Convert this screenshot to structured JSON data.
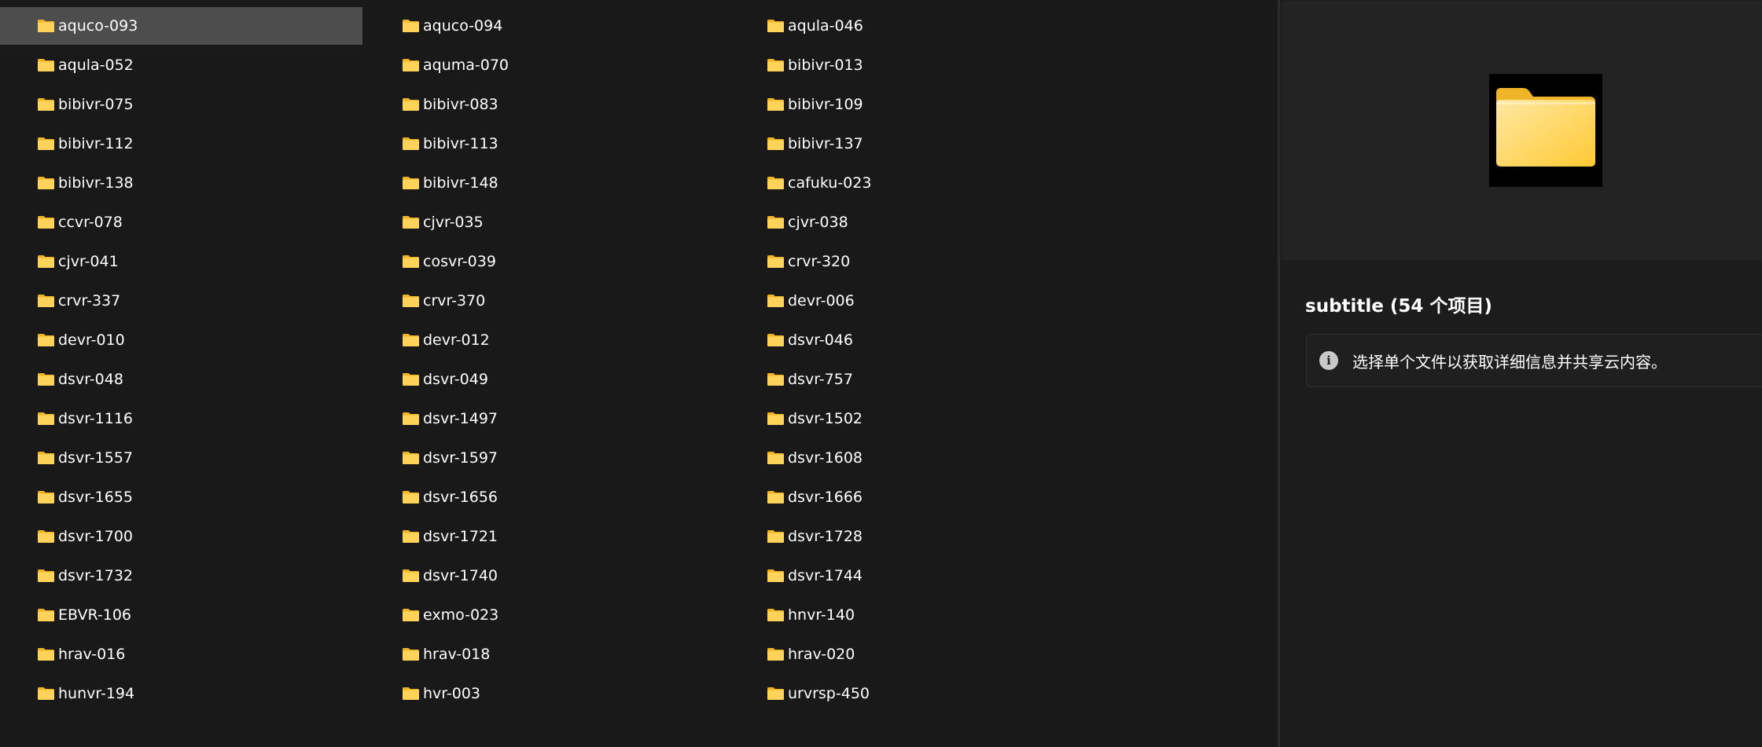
{
  "files": {
    "selected_index": 0,
    "items": [
      "aquco-093",
      "aquco-094",
      "aqula-046",
      "aqula-052",
      "aquma-070",
      "bibivr-013",
      "bibivr-075",
      "bibivr-083",
      "bibivr-109",
      "bibivr-112",
      "bibivr-113",
      "bibivr-137",
      "bibivr-138",
      "bibivr-148",
      "cafuku-023",
      "ccvr-078",
      "cjvr-035",
      "cjvr-038",
      "cjvr-041",
      "cosvr-039",
      "crvr-320",
      "crvr-337",
      "crvr-370",
      "devr-006",
      "devr-010",
      "devr-012",
      "dsvr-046",
      "dsvr-048",
      "dsvr-049",
      "dsvr-757",
      "dsvr-1116",
      "dsvr-1497",
      "dsvr-1502",
      "dsvr-1557",
      "dsvr-1597",
      "dsvr-1608",
      "dsvr-1655",
      "dsvr-1656",
      "dsvr-1666",
      "dsvr-1700",
      "dsvr-1721",
      "dsvr-1728",
      "dsvr-1732",
      "dsvr-1740",
      "dsvr-1744",
      "EBVR-106",
      "exmo-023",
      "hnvr-140",
      "hrav-016",
      "hrav-018",
      "hrav-020",
      "hunvr-194",
      "hvr-003",
      "urvrsp-450"
    ],
    "icon": "folder-icon"
  },
  "details": {
    "title": "subtitle (54 个项目)",
    "info_icon": "info-icon",
    "info_text": "选择单个文件以获取详细信息并共享云内容。",
    "preview_icon": "folder-large-icon"
  },
  "colors": {
    "background": "#191919",
    "selection": "#4d4d4d",
    "details_background": "#1c1c1c",
    "preview_background": "#232323",
    "folder_yellow": "#ffd35a",
    "folder_tab": "#f0b429"
  }
}
